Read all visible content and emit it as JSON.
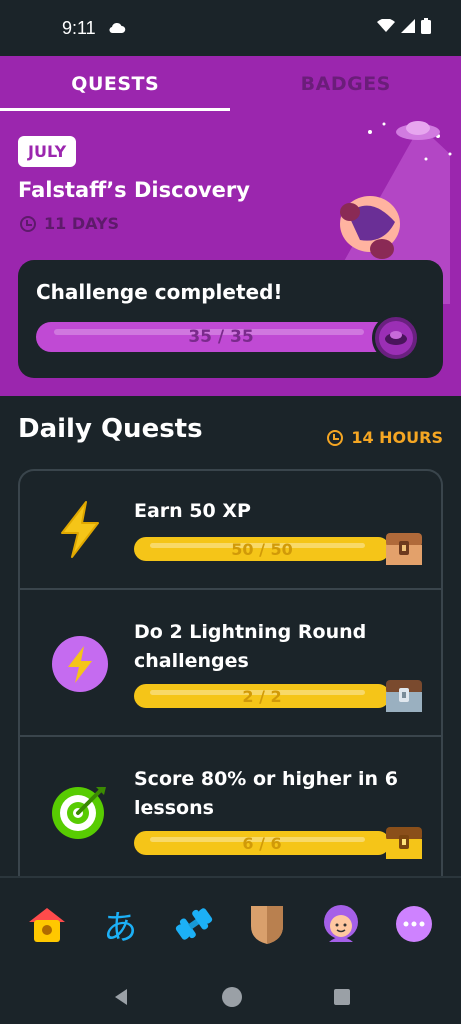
{
  "status_bar": {
    "time": "9:11"
  },
  "tabs": [
    {
      "label": "QUESTS",
      "active": true
    },
    {
      "label": "BADGES",
      "active": false
    }
  ],
  "monthly": {
    "month_badge": "JULY",
    "title": "Falstaff’s Discovery",
    "days_left": "11 DAYS",
    "challenge": {
      "title": "Challenge completed!",
      "progress_text": "35 / 35",
      "progress": 1.0
    }
  },
  "daily": {
    "title": "Daily Quests",
    "time_left": "14 HOURS",
    "quests": [
      {
        "title": "Earn 50 XP",
        "progress_text": "50 / 50",
        "progress": 1.0,
        "icon": "lightning-icon"
      },
      {
        "title": "Do 2 Lightning Round challenges",
        "progress_text": "2 / 2",
        "progress": 1.0,
        "icon": "lightning-badge-icon"
      },
      {
        "title": "Score 80% or higher in 6 lessons",
        "progress_text": "6 / 6",
        "progress": 1.0,
        "icon": "target-icon"
      }
    ]
  },
  "bottom_nav": {
    "items": [
      "home-icon",
      "characters-icon",
      "dumbbell-icon",
      "shield-icon",
      "profile-icon",
      "more-icon"
    ],
    "characters_glyph": "あ"
  },
  "colors": {
    "purple": "#9b26ae",
    "dark_bg": "#1b2429",
    "gold": "#f5c518",
    "orange": "#f5a623"
  }
}
